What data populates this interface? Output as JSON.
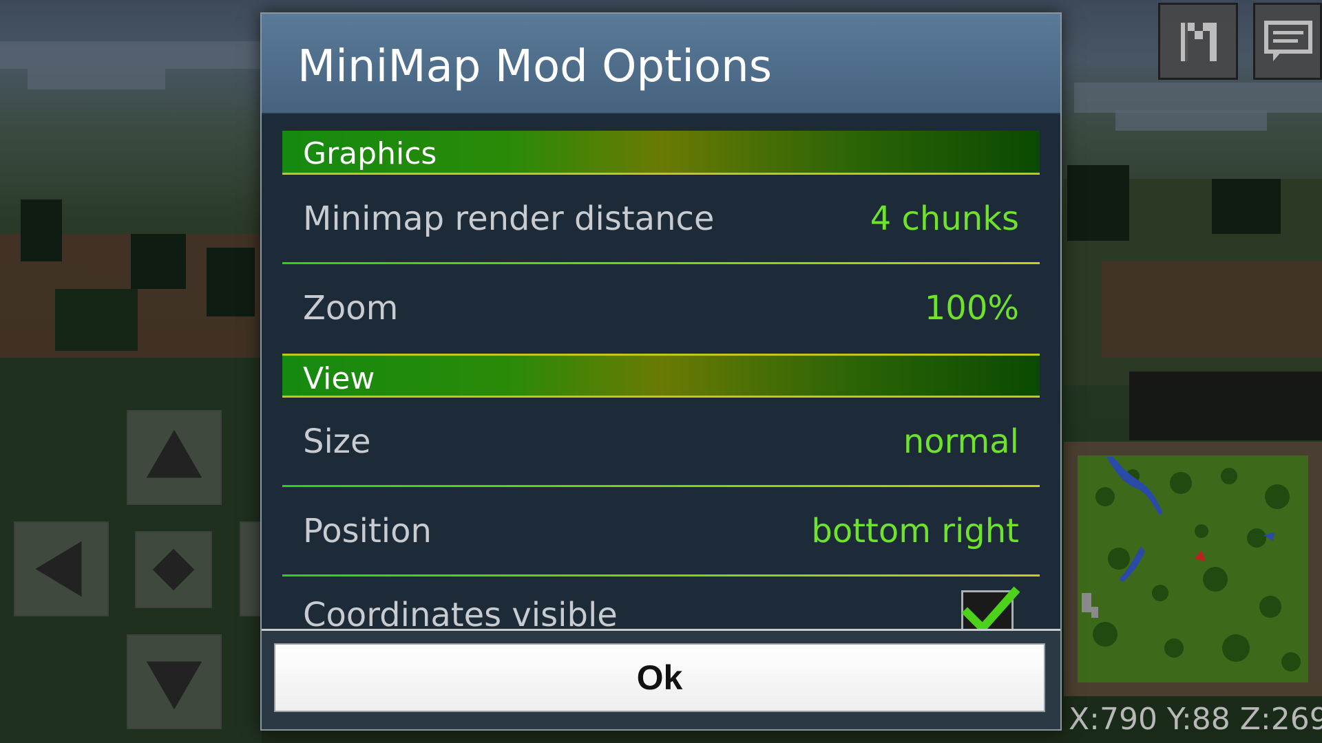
{
  "dialog": {
    "title": "MiniMap Mod Options",
    "sections": [
      {
        "header": "Graphics",
        "rows": [
          {
            "label": "Minimap render distance",
            "value": "4 chunks"
          },
          {
            "label": "Zoom",
            "value": "100%"
          }
        ]
      },
      {
        "header": "View",
        "rows": [
          {
            "label": "Size",
            "value": "normal"
          },
          {
            "label": "Position",
            "value": "bottom right"
          },
          {
            "label": "Coordinates visible",
            "checked": true
          }
        ]
      }
    ],
    "ok_label": "Ok"
  },
  "hud": {
    "map_button_icon": "map-m-icon",
    "chat_button_icon": "chat-icon",
    "coords_text": "X:790 Y:88 Z:269"
  },
  "dpad": {
    "icons": [
      "arrow-up-icon",
      "arrow-left-icon",
      "jump-icon",
      "arrow-right-icon",
      "arrow-down-icon"
    ]
  },
  "colors": {
    "accent_green": "#6fe22a",
    "header_blue": "#4f6e8b",
    "panel_bg": "#1d2b38"
  }
}
